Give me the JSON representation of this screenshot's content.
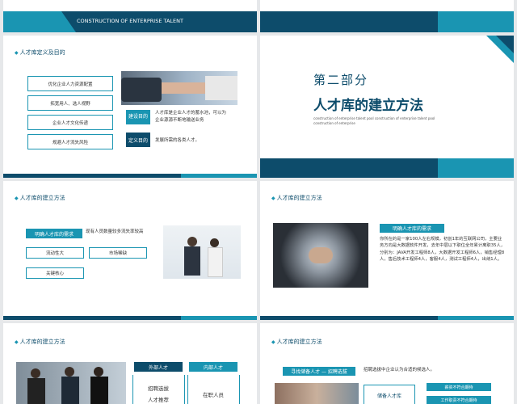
{
  "colors": {
    "teal": "#1a95b2",
    "navy": "#0d4c6b",
    "bg": "#ffffff"
  },
  "slide1": {
    "banner": "CONSTRUCTION OF ENTERPRISE TALENT"
  },
  "slide3": {
    "title": "人才库定义及目的",
    "items": [
      "优化企业人力资源配置",
      "拓宽用人、选人视野",
      "企业人才文化传递",
      "规避人才流失风险"
    ],
    "label1": "建设目的",
    "text1": "人才库是企业人才的蓄水池，可以为企业源源不断地输送业务",
    "label2": "定义目的",
    "text2": "发展所需的各类人才。"
  },
  "slide4": {
    "part": "第二部分",
    "title": "人才库的建立方法",
    "subtitle": "construction of enterprise talent pool construction of enterprise talent pool construction of enterprise"
  },
  "slide5": {
    "title": "人才库的建立方法",
    "need_label": "明确人才库的需求",
    "need_text": "现有人员数量较多流失率较高",
    "tags": [
      "流动性大",
      "市场稀缺",
      "关键核心"
    ]
  },
  "slide6": {
    "title": "人才库的建立方法",
    "label": "明确人才库的需求",
    "text": "你所在的是一家100人左右规模，初创1年的互联网公司，主要业务方向是大数据软件开发，去年中层以下职位全年累计离职35人，分别为：JAVA开发工程师8人，大数据开发工程师6人，销售经理8人，售后技术工程师4人，客服4人，测试工程师4人，出纳1人。"
  },
  "slide7": {
    "title": "人才库的建立方法",
    "col1_head": "外部人才",
    "col1_items": [
      "招聘选拔",
      "人才推荐"
    ],
    "col2_head": "内部人才",
    "col2_items": [
      "在职人员",
      "人才储备"
    ]
  },
  "slide8": {
    "title": "人才库的建立方法",
    "label": "寻找储备人才 — 招聘选拔",
    "text": "招聘选拔中企业认为合适的候选人。",
    "chips": [
      "薪资不符合期待",
      "工作职责不符合期待"
    ],
    "box_text": "储备人才库"
  }
}
